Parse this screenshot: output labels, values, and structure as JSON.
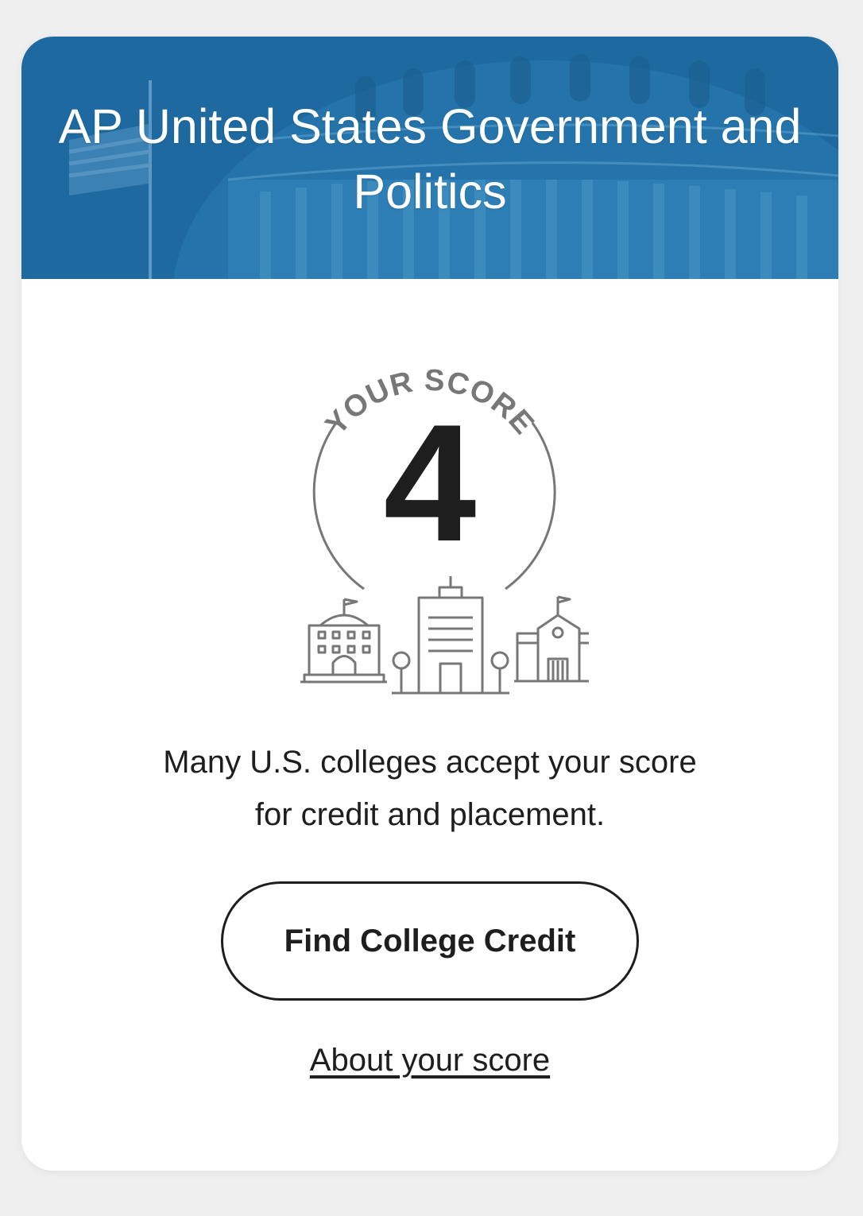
{
  "card": {
    "title": "AP United States Government and Politics",
    "banner_color": "#1e6aa0",
    "banner_icon": "capitol-building-image"
  },
  "score": {
    "label": "YOUR SCORE",
    "value": "4",
    "icon": "college-campus-buildings-icon"
  },
  "message": "Many U.S. colleges accept your score for credit and placement.",
  "actions": {
    "primary_label": "Find College Credit",
    "secondary_link": "About your score"
  },
  "colors": {
    "text": "#1e1e1e",
    "muted": "#777777",
    "background": "#efefef",
    "card": "#ffffff"
  }
}
